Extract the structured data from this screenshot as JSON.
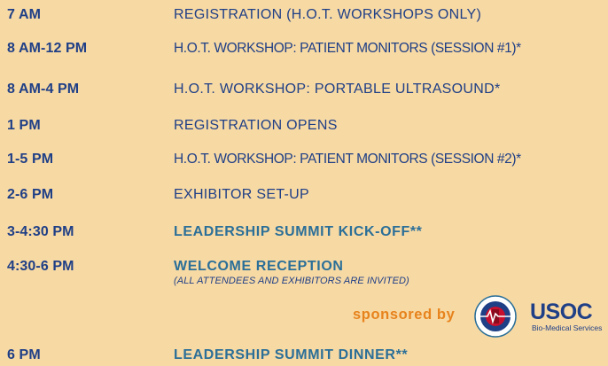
{
  "schedule": [
    {
      "time": "7 AM",
      "event": "REGISTRATION (H.O.T. WORKSHOPS ONLY)"
    },
    {
      "time": "8 AM-12 PM",
      "event": "H.O.T. WORKSHOP: PATIENT MONITORS (SESSION #1)*"
    },
    {
      "time": "8 AM-4 PM",
      "event": "H.O.T. WORKSHOP: PORTABLE ULTRASOUND*"
    },
    {
      "time": "1 PM",
      "event": "REGISTRATION OPENS"
    },
    {
      "time": "1-5 PM",
      "event": "H.O.T. WORKSHOP: PATIENT MONITORS (SESSION #2)*"
    },
    {
      "time": "2-6 PM",
      "event": "EXHIBITOR SET-UP"
    },
    {
      "time": "3-4:30 PM",
      "event": "LEADERSHIP SUMMIT KICK-OFF**"
    },
    {
      "time": "4:30-6 PM",
      "event": "WELCOME RECEPTION",
      "note": "(ALL ATTENDEES AND EXHIBITORS ARE INVITED)"
    },
    {
      "time": "6 PM",
      "event": "LEADERSHIP SUMMIT DINNER**"
    }
  ],
  "sponsor": {
    "label": "sponsored by",
    "logo_text": "USOC",
    "logo_subtext": "Bio-Medical Services"
  },
  "colors": {
    "background": "#f7d9a4",
    "time": "#1f3f86",
    "highlight_event": "#2b6f98",
    "sponsor_label": "#e7831c"
  }
}
